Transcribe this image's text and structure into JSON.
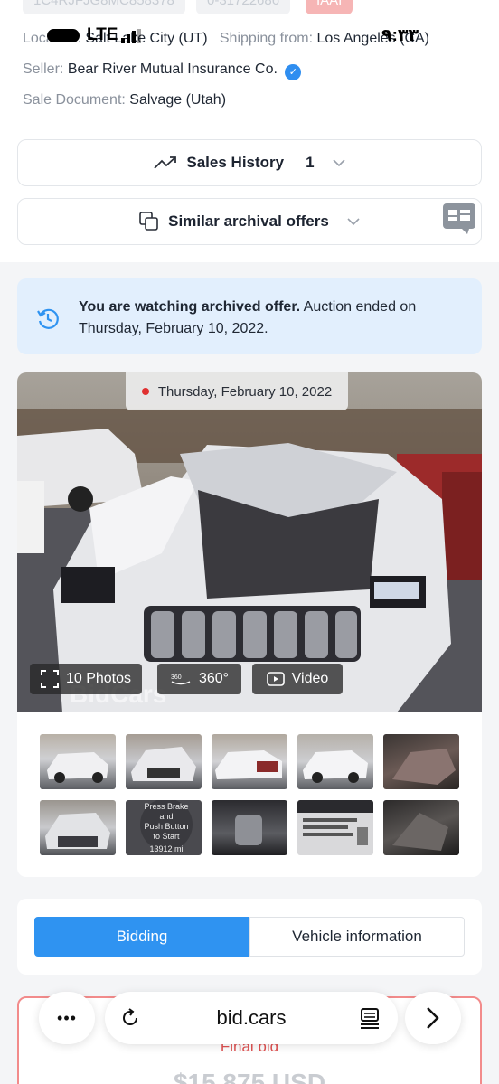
{
  "top_strip": {
    "chips": [
      "1C4RJFJG8MC858378",
      "0-31722686",
      "IAAI"
    ]
  },
  "status_bar": {
    "time": "٩:٣٣",
    "network": "LTE"
  },
  "info": {
    "location_label": "Location:",
    "location_value": "Salt Lake City (UT)",
    "shipping_label": "Shipping from:",
    "shipping_value": "Los Angeles (CA)",
    "seller_label": "Seller:",
    "seller_value": "Bear River Mutual Insurance Co.",
    "sale_doc_label": "Sale Document:",
    "sale_doc_value": "Salvage (Utah)"
  },
  "sales_history": {
    "label": "Sales History",
    "count": "1"
  },
  "similar_offers": {
    "label": "Similar archival offers"
  },
  "banner": {
    "bold": "You are watching archived offer.",
    "rest": " Auction ended on Thursday, February 10, 2022."
  },
  "gallery": {
    "date": "Thursday, February 10, 2022",
    "photos_label": "10 Photos",
    "view360_label": "360°",
    "video_label": "Video",
    "watermark": "BidCars",
    "thumb_sticker_lines": [
      "Press Brake",
      "and",
      "Push Button",
      "to Start",
      "13912 mi"
    ]
  },
  "tabs": {
    "bidding": "Bidding",
    "vehicle_info": "Vehicle information"
  },
  "final_bid": {
    "label": "Final bid",
    "price": "$15,875 USD"
  },
  "browser": {
    "url": "bid.cars",
    "more": "•••"
  },
  "colors": {
    "accent": "#2f93f1",
    "banner_bg": "#e2effd",
    "final_border": "#f28b8b"
  }
}
